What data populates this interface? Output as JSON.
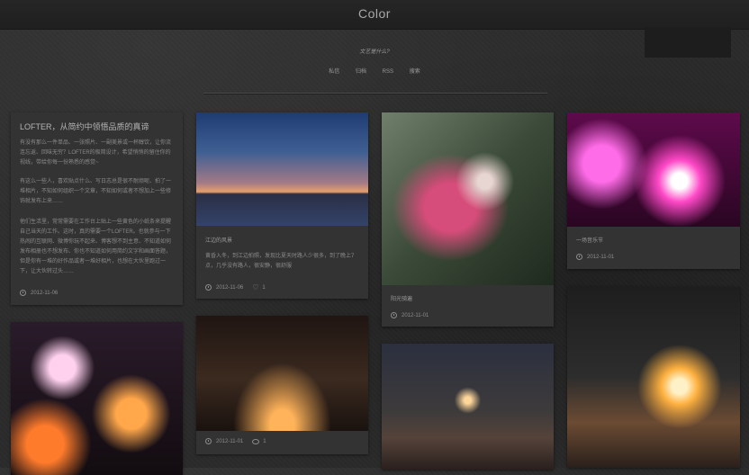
{
  "site": {
    "title": "Color",
    "tagline": "文艺是什么?"
  },
  "nav": {
    "items": [
      "私信",
      "归档",
      "RSS",
      "搜索"
    ]
  },
  "posts": {
    "intro": {
      "title": "LOFTER，从简约中领悟品质的真谛",
      "paragraphs": [
        "有没有那么一件单品、一张照片、一副美景或一杯醇饮，让你流连忘返、回味无穷？LOFTER的极简设计，希望悄悄的留住你的视线，带给你每一份熟悉的感觉~",
        "有这么一些人，喜欢贴点什么、写日志总是很不耐烦呢、拍了一堆相片，不知如何组织一个文章，不知如何或者不想加上一些修饰就发布上来……",
        "他们生活里，常常需要在工作台上贴上一些黄色的小纸条来提醒自己当天的工作。这时，真的需要一个LOFTER。也就参与一下热闹的互联网、微博你玩不起来、博客想不到主意、不知道如何发布相册也不想发布、你也不知道如何用简约文字和画面答题，但是你有一堆的好作品或者一堆好相片，也想在大伙里跑过一下，让大伙转过头……"
      ],
      "date": "2012-11-06"
    },
    "sky": {
      "caption": "江边的风景",
      "text": "黄昏入冬，到江边拍照，发现比夏天时路人少很多，到了晚上7点，几乎没有路人，很安静，很舒服",
      "date": "2012-11-06",
      "likes": "1"
    },
    "glove": {
      "caption": "阳光骑遍",
      "date": "2012-11-01"
    },
    "band": {
      "caption": "一场音乐节",
      "date": "2012-11-01"
    },
    "crane": {
      "date": "2012-11-01",
      "comments": "1"
    }
  }
}
